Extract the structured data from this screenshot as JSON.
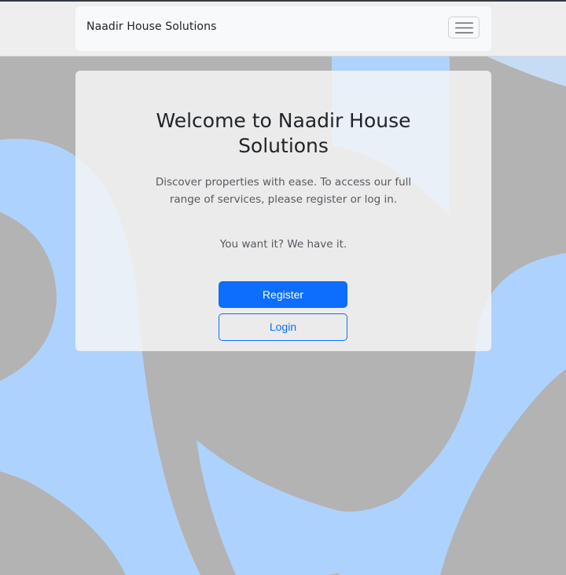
{
  "navbar": {
    "brand": "Naadir House Solutions",
    "toggler_icon": "hamburger-menu-icon"
  },
  "hero": {
    "title": "Welcome to Naadir House Solutions",
    "lead": "Discover properties with ease. To access our full range of services, please register or log in.",
    "tagline": "You want it? We have it."
  },
  "actions": {
    "register_label": "Register",
    "login_label": "Login"
  },
  "colors": {
    "background_gray": "#b3b3b3",
    "background_blue": "#aed2fe",
    "primary": "#0d6efd"
  }
}
